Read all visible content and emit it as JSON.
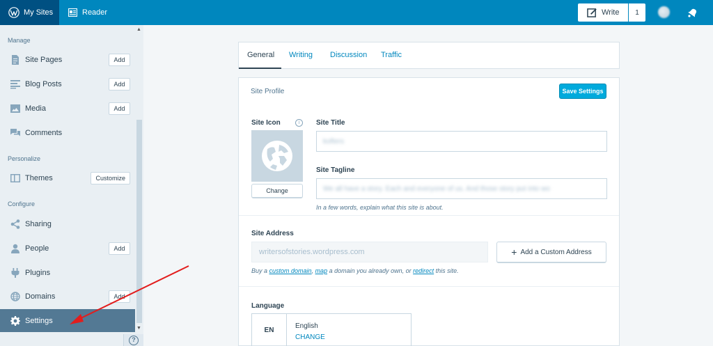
{
  "masterbar": {
    "my_sites": "My Sites",
    "reader": "Reader",
    "write": "Write",
    "drafts_count": "1"
  },
  "sidebar": {
    "sections": [
      {
        "heading": "Manage"
      },
      {
        "heading": "Personalize"
      },
      {
        "heading": "Configure"
      }
    ],
    "items": [
      {
        "label": "Site Pages",
        "action": "Add"
      },
      {
        "label": "Blog Posts",
        "action": "Add"
      },
      {
        "label": "Media",
        "action": "Add"
      },
      {
        "label": "Comments"
      },
      {
        "label": "Themes",
        "action": "Customize"
      },
      {
        "label": "Sharing"
      },
      {
        "label": "People",
        "action": "Add"
      },
      {
        "label": "Plugins"
      },
      {
        "label": "Domains",
        "action": "Add"
      },
      {
        "label": "Settings"
      }
    ],
    "help": "?"
  },
  "tabs": [
    "General",
    "Writing",
    "Discussion",
    "Traffic"
  ],
  "profile": {
    "title": "Site Profile",
    "save": "Save Settings",
    "site_icon_label": "Site Icon",
    "info": "i",
    "change": "Change",
    "site_title_label": "Site Title",
    "site_title_value": "kofters",
    "tagline_label": "Site Tagline",
    "tagline_value": "We all have a story. Each and everyone of us. And those story put into wo",
    "tagline_hint": "In a few words, explain what this site is about.",
    "address_label": "Site Address",
    "address_value": "writersofstories.wordpress.com",
    "custom_address": "Add a Custom Address",
    "address_hint": {
      "prefix": "Buy a ",
      "link1": "custom domain",
      "sep1": ", ",
      "link2": "map",
      "middle": " a domain you already own, or ",
      "link3": "redirect",
      "suffix": " this site."
    },
    "language_label": "Language",
    "language_code": "EN",
    "language_name": "English",
    "language_change": "CHANGE"
  },
  "colors": {
    "masterbar": "#0087be",
    "masterbar_active": "#005082",
    "sidebar": "#e9eff3",
    "selected": "#537994",
    "primary": "#00aadc",
    "annotation_arrow": "#e21d1d"
  }
}
